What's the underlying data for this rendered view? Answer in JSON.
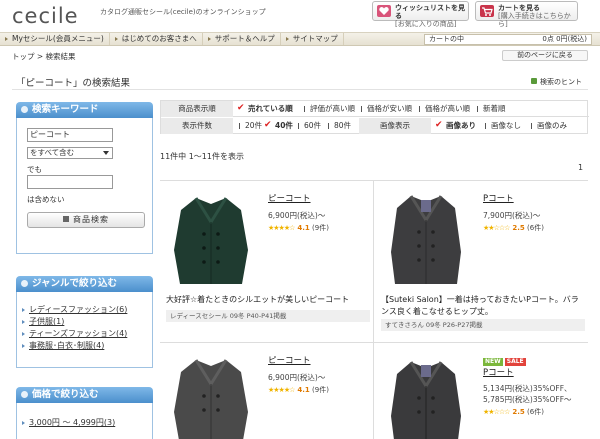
{
  "header": {
    "logo": "cecile",
    "tagline": "カタログ通販セシール(cecile)のオンラインショップ",
    "wishlist": {
      "line1": "ウィッシュリストを見る",
      "line2": "[お気に入りの商品]"
    },
    "cart": {
      "line1": "カートを見る",
      "line2": "[購入手続きはこちらから]"
    }
  },
  "nav": {
    "items": [
      "Myセシール(会員メニュー)",
      "はじめてのお客さまへ",
      "サポート＆ヘルプ",
      "サイトマップ"
    ],
    "cart_label": "カートの中",
    "cart_value": "0点  0円(税込)"
  },
  "breadcrumb": "トップ > 検索結果",
  "back_button": "前のページに戻る",
  "page_title": "「ピーコート」の検索結果",
  "hint_link": "検索のヒント",
  "keyword_panel": {
    "title": "検索キーワード",
    "keyword_value": "ピーコート",
    "mode": "をすべて含む",
    "label_and": "でも",
    "label_exclude": "は含めない",
    "search_button": "商品検索"
  },
  "genre_panel": {
    "title": "ジャンルで絞り込む",
    "items": [
      "レディースファッション(6)",
      "子供服(1)",
      "ティーンズファッション(4)",
      "事務服･白衣･制服(4)"
    ]
  },
  "price_panel": {
    "title": "価格で絞り込む",
    "items": [
      "3,000円 ～ 4,999円(3)"
    ]
  },
  "filters": {
    "sort_label": "商品表示順",
    "sort_options": [
      "売れている順",
      "評価が高い順",
      "価格が安い順",
      "価格が高い順",
      "新着順"
    ],
    "count_label": "表示件数",
    "count_options": [
      "20件",
      "40件",
      "60件",
      "80件"
    ],
    "image_label": "画像表示",
    "image_options": [
      "画像あり",
      "画像なし",
      "画像のみ"
    ]
  },
  "result_count": "11件中 1〜11件を表示",
  "page_number": "1",
  "products": [
    {
      "name": "ピーコート",
      "price": "6,900円(税込)〜",
      "rating": "4.1",
      "reviews": "(9件)",
      "desc": "大好評☆着たときのシルエットが美しいピーコート",
      "magazine": "レディースセシール 09冬 P40-P41掲載",
      "color": "#1f3b30"
    },
    {
      "name": "Pコート",
      "price": "7,900円(税込)〜",
      "rating": "2.5",
      "reviews": "(6件)",
      "desc": "【Suteki Salon】一着は持っておきたいPコート。バランス良く着こなせるヒップ丈。",
      "magazine": "すてきさろん 09冬  P26-P27掲載",
      "color": "#3d3d3f"
    },
    {
      "name": "ピーコート",
      "price": "6,900円(税込)〜",
      "rating": "4.1",
      "reviews": "(9件)",
      "color": "#4a4a4a"
    },
    {
      "name": "Pコート",
      "price": "5,134円(税込)35%OFF、",
      "price2": "5,785円(税込)35%OFF〜",
      "rating": "2.5",
      "reviews": "(6件)",
      "badge_new": "NEW",
      "badge_sale": "SALE",
      "color": "#3a3a3c"
    }
  ]
}
